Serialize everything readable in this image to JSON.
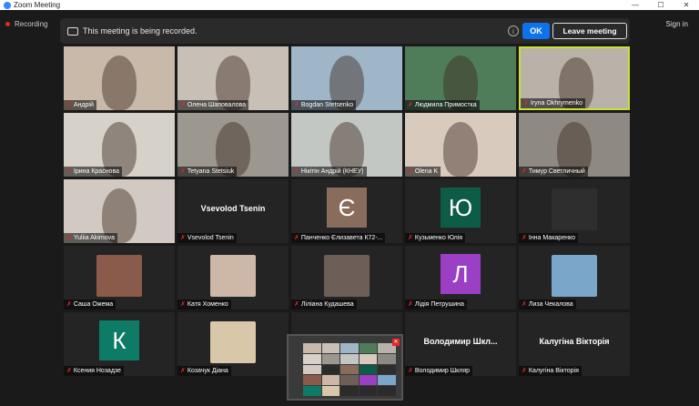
{
  "app": {
    "title": "Zoom Meeting"
  },
  "window": {
    "minimize": "—",
    "maximize": "☐",
    "close": "✕"
  },
  "status": {
    "recording_label": "Recording",
    "signin_label": "Sign in"
  },
  "banner": {
    "message": "This meeting is being recorded.",
    "info": "i",
    "ok_label": "OK",
    "leave_label": "Leave meeting"
  },
  "participants": [
    {
      "name": "Андрій",
      "kind": "video",
      "bg": "#c9b9a8"
    },
    {
      "name": "Олена Шаповалова",
      "kind": "video",
      "bg": "#c8c0b7"
    },
    {
      "name": "Bogdan Stetsenko",
      "kind": "video",
      "bg": "#9eb6c7"
    },
    {
      "name": "Людмила Примостка",
      "kind": "video",
      "bg": "#4f7d5a"
    },
    {
      "name": "Iryna Okhrymenko",
      "kind": "video",
      "bg": "#b8b2a8"
    },
    {
      "name": "Ірина Краснова",
      "kind": "video",
      "bg": "#d6d2c9"
    },
    {
      "name": "Tetyana Stetsiuk",
      "kind": "video",
      "bg": "#9c978f"
    },
    {
      "name": "Нікітін Андрій (КНЕУ)",
      "kind": "video",
      "bg": "#c3c7c4"
    },
    {
      "name": "Olena K",
      "kind": "video",
      "bg": "#d8cbbd"
    },
    {
      "name": "Тимур Светличный",
      "kind": "video",
      "bg": "#8e8a83"
    },
    {
      "name": "Yuliia Akimova",
      "kind": "video",
      "bg": "#d2cac2"
    },
    {
      "name": "Vsevolod Tsenin",
      "kind": "name",
      "display": "Vsevolod Tsenin"
    },
    {
      "name": "Панченко Єлизавета К72-...",
      "kind": "letter",
      "letter": "Є",
      "bg": "#8a6c5c"
    },
    {
      "name": "Кузьменко Юлія",
      "kind": "letter",
      "letter": "Ю",
      "bg": "#0c5c48"
    },
    {
      "name": "Інна Макаренко",
      "kind": "photo",
      "bg": "#2e2e2e"
    },
    {
      "name": "Саша Ожема",
      "kind": "photo",
      "bg": "#8a5a4a"
    },
    {
      "name": "Катя Хоменко",
      "kind": "photo",
      "bg": "#cdb8a8"
    },
    {
      "name": "Ліліана Кудашева",
      "kind": "photo",
      "bg": "#6d5f58"
    },
    {
      "name": "Лідія Петрушина",
      "kind": "letter",
      "letter": "Л",
      "bg": "#9b3fc4"
    },
    {
      "name": "Лиза Чекалова",
      "kind": "photo",
      "bg": "#7aa7c9"
    },
    {
      "name": "Ксения Нозадзе",
      "kind": "letter",
      "letter": "К",
      "bg": "#0d7b66"
    },
    {
      "name": "Козачук Діана",
      "kind": "photo",
      "bg": "#d9c7a9"
    },
    {
      "name": "",
      "kind": "empty"
    },
    {
      "name": "Володимир Шкляр",
      "kind": "name",
      "display": "Володимир Шкл..."
    },
    {
      "name": "Калугіна Вікторія",
      "kind": "name",
      "display": "Калугіна Вікторія"
    }
  ]
}
